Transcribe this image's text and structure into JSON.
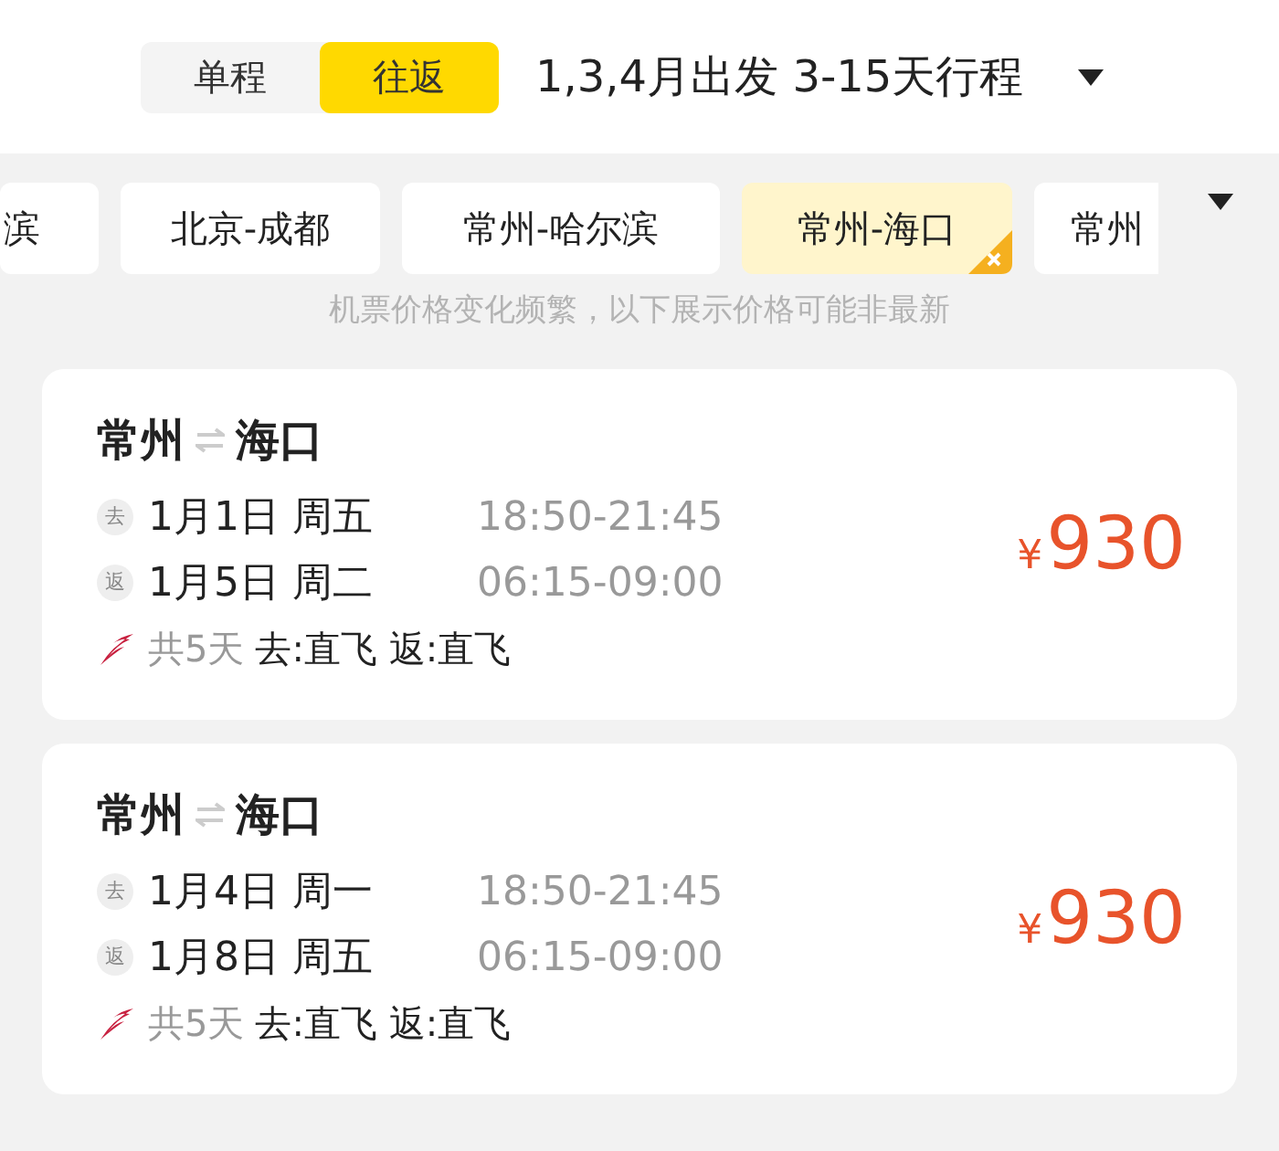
{
  "trip_types": [
    {
      "label": "单程",
      "selected": false
    },
    {
      "label": "往返",
      "selected": true
    }
  ],
  "filter": {
    "label": "1,3,4月出发 3-15天行程"
  },
  "routes": [
    {
      "label": "滨",
      "selected": false
    },
    {
      "label": "北京-成都",
      "selected": false
    },
    {
      "label": "常州-哈尔滨",
      "selected": false
    },
    {
      "label": "常州-海口",
      "selected": true
    },
    {
      "label": "常州",
      "selected": false
    }
  ],
  "notice": "机票价格变化频繁，以下展示价格可能非最新",
  "flights": [
    {
      "from": "常州",
      "to": "海口",
      "legs": [
        {
          "tag": "去",
          "date": "1月1日 周五",
          "time": "18:50-21:45"
        },
        {
          "tag": "返",
          "date": "1月5日 周二",
          "time": "06:15-09:00"
        }
      ],
      "duration": "共5天",
      "stops": "去:直飞 返:直飞",
      "currency": "¥",
      "price": "930"
    },
    {
      "from": "常州",
      "to": "海口",
      "legs": [
        {
          "tag": "去",
          "date": "1月4日 周一",
          "time": "18:50-21:45"
        },
        {
          "tag": "返",
          "date": "1月8日 周五",
          "time": "06:15-09:00"
        }
      ],
      "duration": "共5天",
      "stops": "去:直飞 返:直飞",
      "currency": "¥",
      "price": "930"
    }
  ]
}
